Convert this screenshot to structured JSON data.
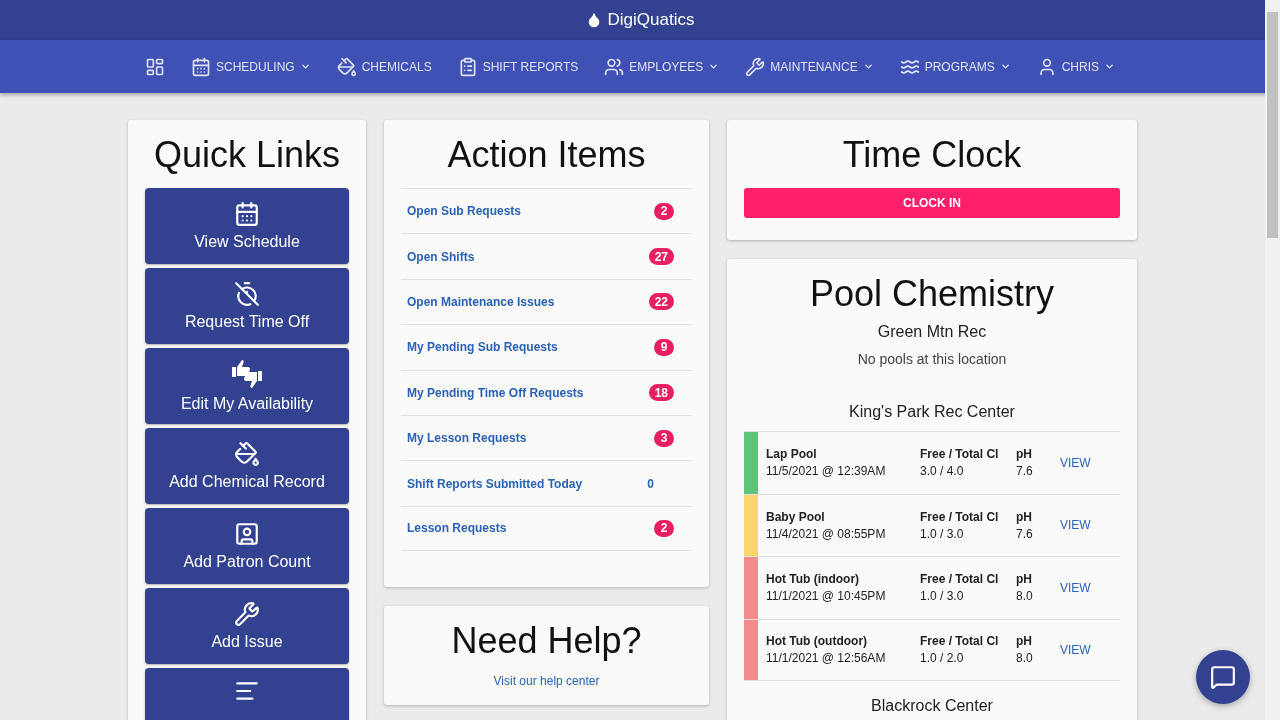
{
  "app": {
    "title": "DigiQuatics"
  },
  "nav": [
    {
      "dropdown": false
    },
    {
      "label": "SCHEDULING",
      "dropdown": true
    },
    {
      "label": "CHEMICALS",
      "dropdown": false
    },
    {
      "label": "SHIFT REPORTS",
      "dropdown": false
    },
    {
      "label": "EMPLOYEES",
      "dropdown": true
    },
    {
      "label": "MAINTENANCE",
      "dropdown": true
    },
    {
      "label": "PROGRAMS",
      "dropdown": true
    },
    {
      "label": "CHRIS",
      "dropdown": true
    }
  ],
  "quick_links": {
    "title": "Quick Links",
    "items": [
      {
        "kind": "full",
        "label": "View Schedule"
      },
      {
        "kind": "full",
        "label": "Request Time Off"
      },
      {
        "kind": "full",
        "label": "Edit My Availability"
      },
      {
        "kind": "full",
        "label": "Add Chemical Record"
      },
      {
        "kind": "full",
        "label": "Add Patron Count"
      },
      {
        "kind": "full",
        "label": "Add Issue"
      },
      {
        "kind": "cut"
      }
    ]
  },
  "action_items": {
    "title": "Action Items",
    "items": [
      {
        "label": "Open Sub Requests",
        "count": "2",
        "kind": "badge"
      },
      {
        "label": "Open Shifts",
        "count": "27",
        "kind": "badge"
      },
      {
        "label": "Open Maintenance Issues",
        "count": "22",
        "kind": "badge"
      },
      {
        "label": "My Pending Sub Requests",
        "count": "9",
        "kind": "badge"
      },
      {
        "label": "My Pending Time Off Requests",
        "count": "18",
        "kind": "badge"
      },
      {
        "label": "My Lesson Requests",
        "count": "3",
        "kind": "badge"
      },
      {
        "label": "Shift Reports Submitted Today",
        "count": "0",
        "kind": "plain"
      },
      {
        "label": "Lesson Requests",
        "count": "2",
        "kind": "badge"
      }
    ]
  },
  "need_help": {
    "title": "Need Help?",
    "link": "Visit our help center"
  },
  "time_clock": {
    "title": "Time Clock",
    "button": "CLOCK IN"
  },
  "pool_chemistry": {
    "title": "Pool Chemistry",
    "locations": [
      {
        "name": "Green Mtn Rec",
        "empty_message": "No pools at this location"
      },
      {
        "name": "King's Park Rec Center",
        "pools": [
          {
            "name": "Lap Pool",
            "time": "11/5/2021 @ 12:39AM",
            "cl_label": "Free / Total Cl",
            "cl": "3.0 / 4.0",
            "ph_label": "pH",
            "ph": "7.6",
            "link": "VIEW",
            "color": "#5ec47a"
          },
          {
            "name": "Baby Pool",
            "time": "11/4/2021 @ 08:55PM",
            "cl_label": "Free / Total Cl",
            "cl": "1.0 / 3.0",
            "ph_label": "pH",
            "ph": "7.6",
            "link": "VIEW",
            "color": "#f9d56e"
          },
          {
            "name": "Hot Tub (indoor)",
            "time": "11/1/2021 @ 10:45PM",
            "cl_label": "Free / Total Cl",
            "cl": "1.0 / 3.0",
            "ph_label": "pH",
            "ph": "8.0",
            "link": "VIEW",
            "color": "#f28b8b"
          },
          {
            "name": "Hot Tub (outdoor)",
            "time": "11/1/2021 @ 12:56AM",
            "cl_label": "Free / Total Cl",
            "cl": "1.0 / 2.0",
            "ph_label": "pH",
            "ph": "8.0",
            "link": "VIEW",
            "color": "#f28b8b"
          }
        ]
      },
      {
        "name": "Blackrock Center"
      }
    ]
  }
}
